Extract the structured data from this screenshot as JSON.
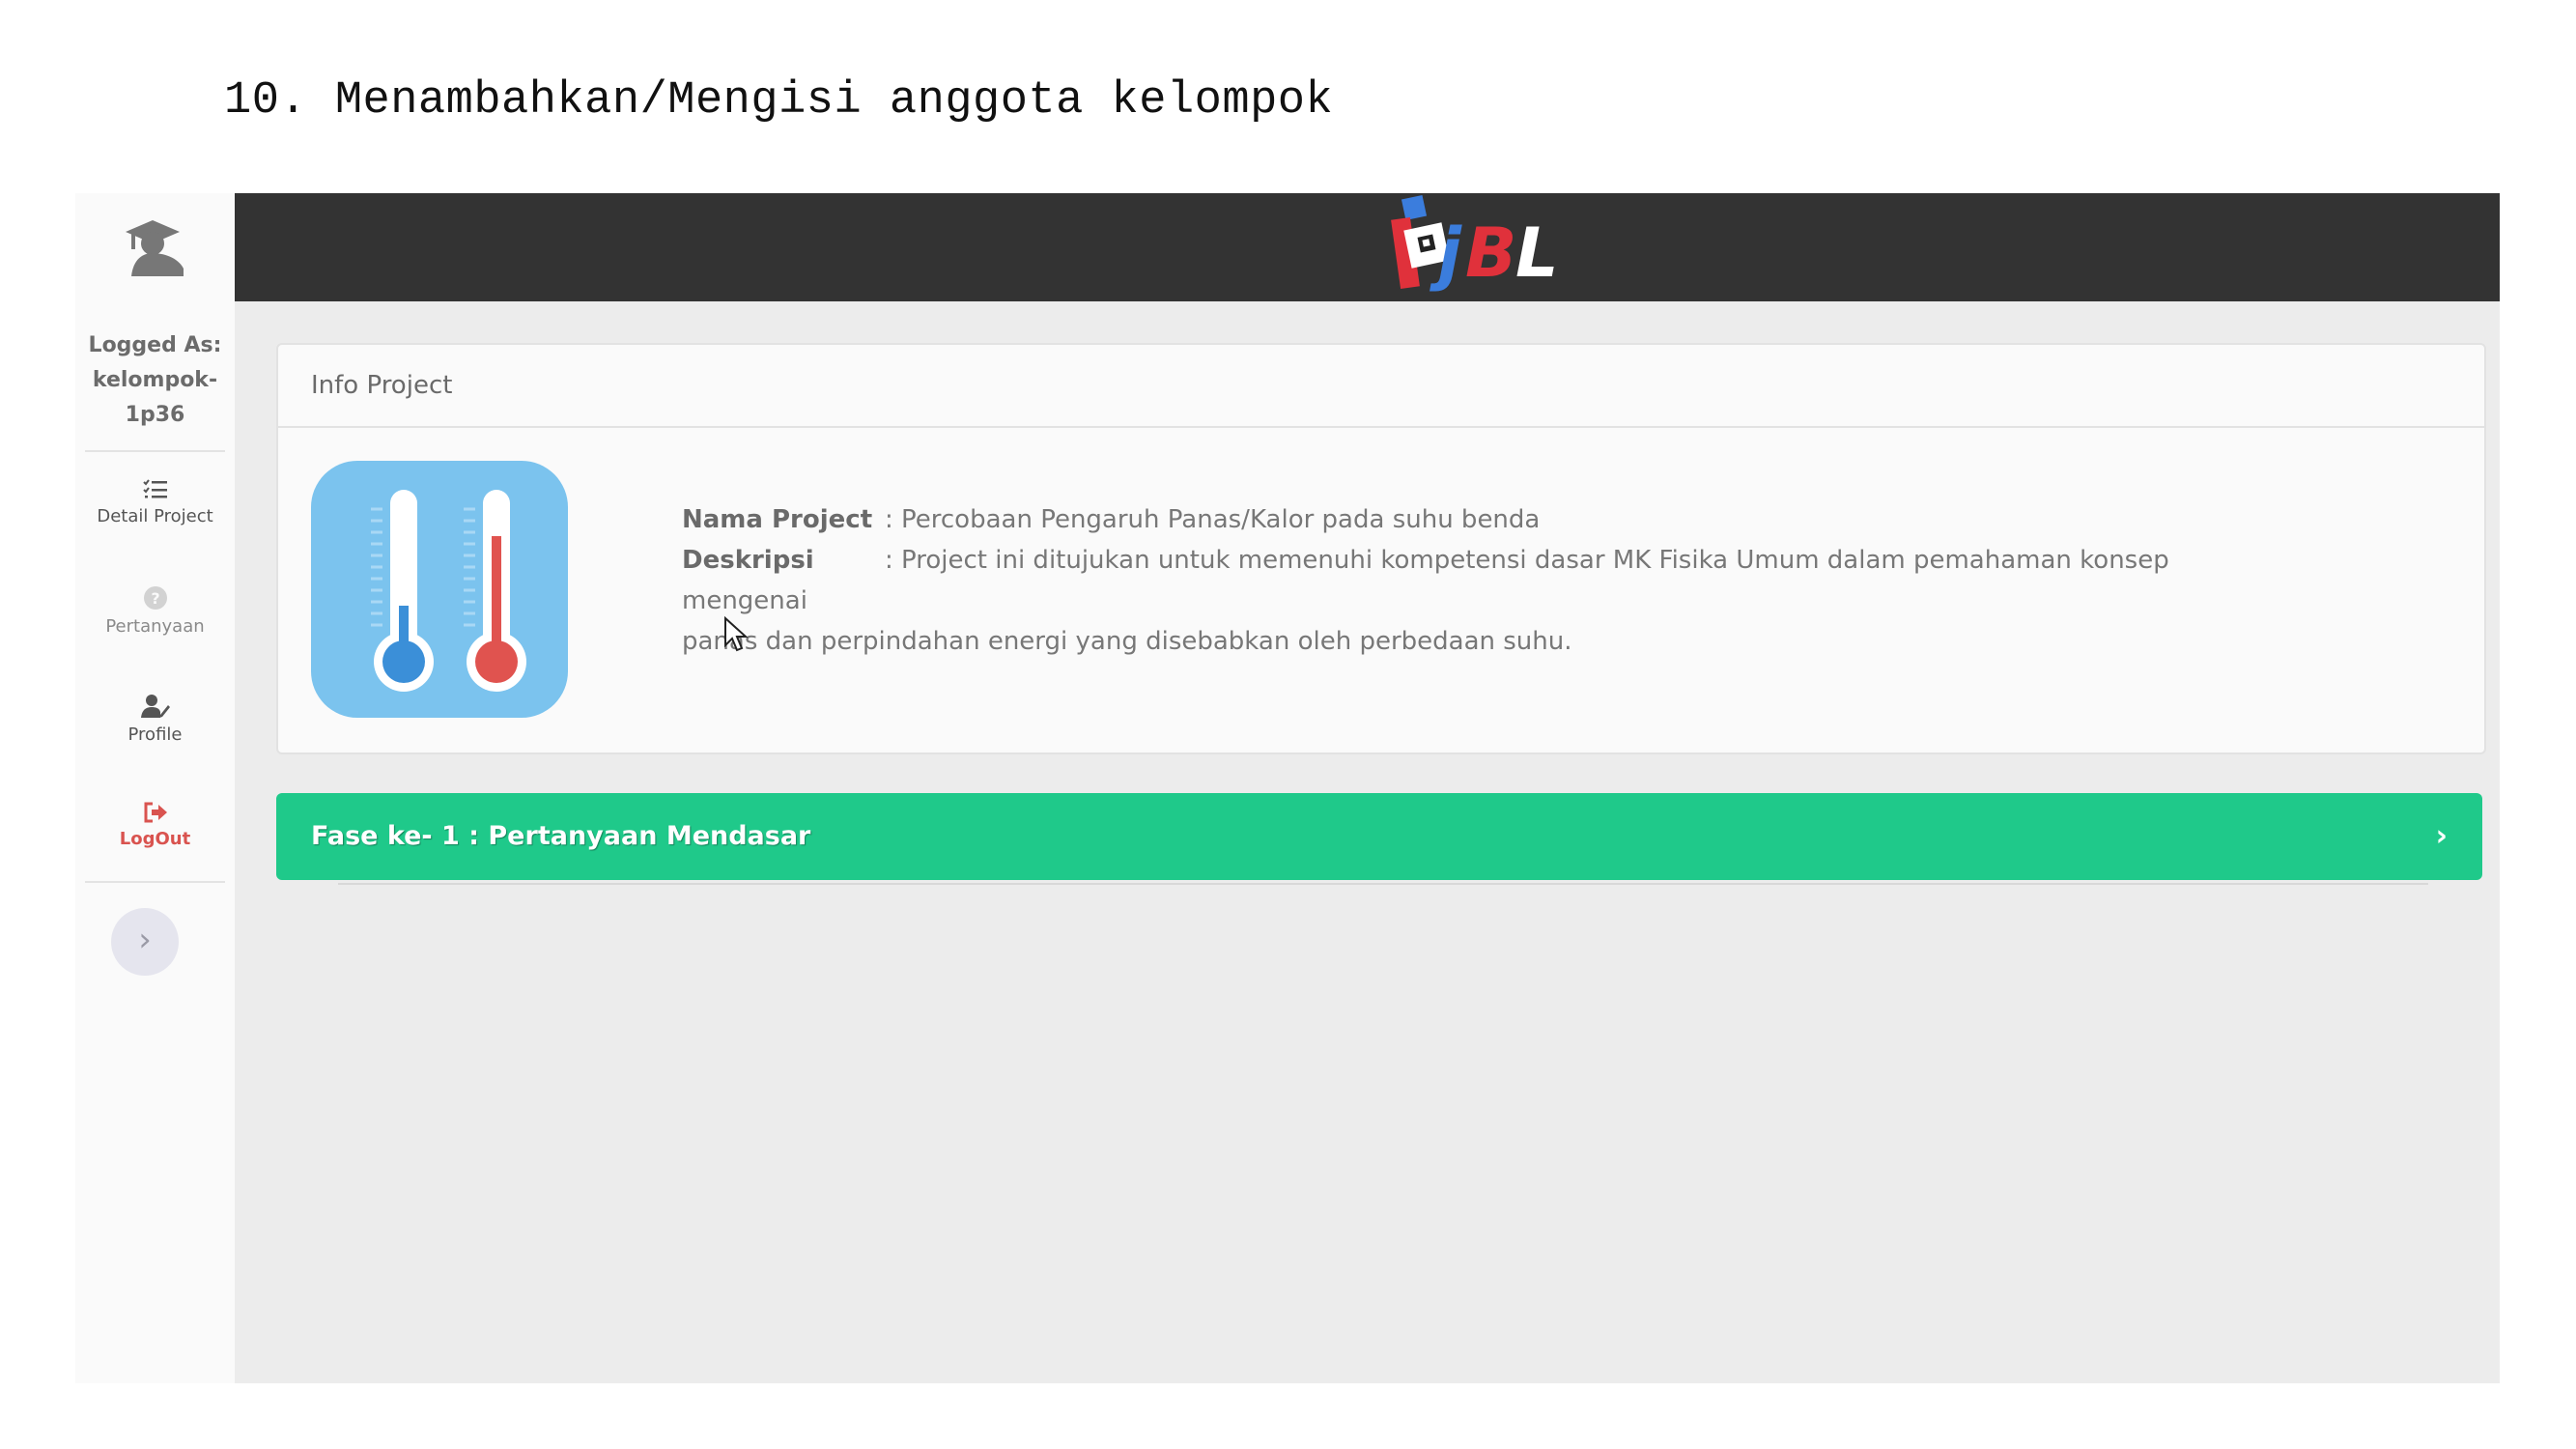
{
  "document": {
    "step_heading": "10. Menambahkan/Mengisi anggota kelompok"
  },
  "sidebar": {
    "logged_label": "Logged As:",
    "username_line1": "kelompok-",
    "username_line2": "1p36",
    "items": [
      {
        "label": "Detail Project",
        "icon": "list-check-icon"
      },
      {
        "label": "Pertanyaan",
        "icon": "question-circle-icon"
      },
      {
        "label": "Profile",
        "icon": "user-edit-icon"
      },
      {
        "label": "LogOut",
        "icon": "sign-out-icon"
      }
    ],
    "toggle_symbol": "›"
  },
  "topbar": {
    "brand": "PjBL",
    "brand_colors": {
      "blue": "#3b7ddd",
      "red": "#e0313b",
      "white": "#ffffff"
    }
  },
  "info_card": {
    "title": "Info Project",
    "nama_label": "Nama Project",
    "nama_value": ": Percobaan Pengaruh Panas/Kalor pada suhu benda",
    "deskripsi_label": "Deskripsi",
    "deskripsi_value": ": Project ini ditujukan untuk memenuhi kompetensi dasar MK Fisika Umum dalam pemahaman konsep mengenai",
    "deskripsi_cont": "panas dan perpindahan energi yang disebabkan oleh perbedaan suhu.",
    "image_icon": "thermometers-icon"
  },
  "phase": {
    "label": "Fase ke- 1 : Pertanyaan Mendasar",
    "chevron": "›",
    "color": "#1fc98a"
  }
}
